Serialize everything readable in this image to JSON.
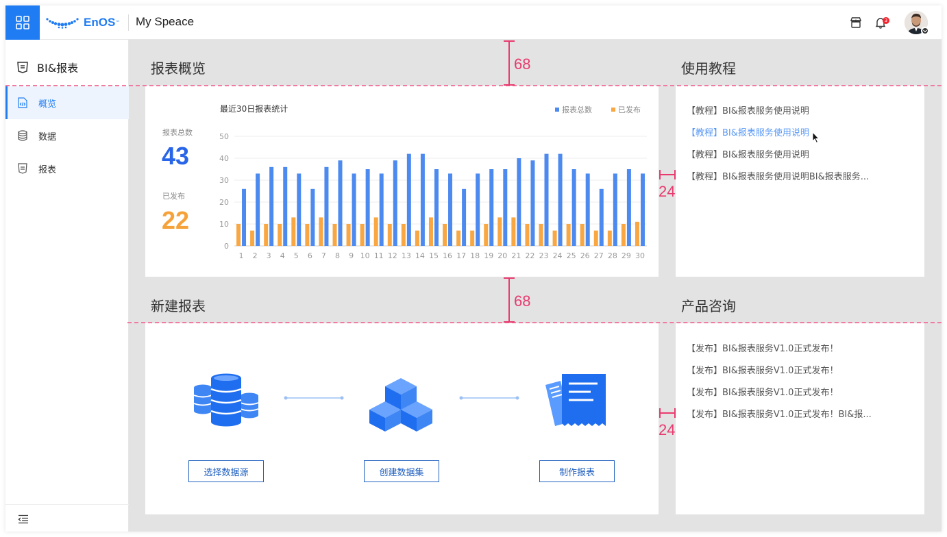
{
  "header": {
    "app_title": "My Speace",
    "logo_text": "EnOS",
    "logo_tm": "™",
    "notification_count": "3"
  },
  "sidebar": {
    "title": "BI&报表",
    "items": [
      {
        "label": "概览",
        "icon": "code-file-icon",
        "active": true
      },
      {
        "label": "数据",
        "icon": "database-icon",
        "active": false
      },
      {
        "label": "报表",
        "icon": "report-icon",
        "active": false
      }
    ]
  },
  "overview": {
    "section_title": "报表概览",
    "total_label": "报表总数",
    "total_value": "43",
    "published_label": "已发布",
    "published_value": "22",
    "colors": {
      "total": "#2865e8",
      "published": "#f6a23b"
    }
  },
  "chart_data": {
    "type": "bar",
    "title": "最近30日报表统计",
    "categories": [
      "1",
      "2",
      "3",
      "4",
      "5",
      "6",
      "7",
      "8",
      "9",
      "10",
      "11",
      "12",
      "13",
      "14",
      "15",
      "16",
      "17",
      "18",
      "19",
      "20",
      "21",
      "22",
      "23",
      "24",
      "25",
      "26",
      "27",
      "28",
      "29",
      "30"
    ],
    "series": [
      {
        "name": "报表总数",
        "color": "#4c8af0",
        "values": [
          26,
          33,
          36,
          36,
          33,
          26,
          36,
          39,
          33,
          35,
          33,
          39,
          42,
          42,
          35,
          33,
          26,
          33,
          35,
          35,
          40,
          39,
          42,
          42,
          35,
          33,
          26,
          33,
          35,
          33
        ]
      },
      {
        "name": "已发布",
        "color": "#f8a742",
        "values": [
          10,
          7,
          10,
          10,
          13,
          10,
          13,
          10,
          10,
          10,
          13,
          10,
          10,
          7,
          13,
          10,
          7,
          7,
          10,
          13,
          13,
          10,
          10,
          7,
          10,
          10,
          7,
          7,
          10,
          11
        ]
      }
    ],
    "yticks": [
      0,
      10,
      20,
      30,
      40,
      50
    ],
    "ylim": [
      0,
      50
    ],
    "legend_position": "top-right",
    "grid": true
  },
  "tutorial": {
    "section_title": "使用教程",
    "items": [
      "【教程】BI&报表服务使用说明",
      "【教程】BI&报表服务使用说明",
      "【教程】BI&报表服务使用说明",
      "【教程】BI&报表服务使用说明BI&报表服务..."
    ]
  },
  "new_report": {
    "section_title": "新建报表",
    "steps": [
      {
        "label": "选择数据源",
        "icon": "database-stack-icon"
      },
      {
        "label": "创建数据集",
        "icon": "cubes-icon"
      },
      {
        "label": "制作报表",
        "icon": "report-document-icon"
      }
    ]
  },
  "consult": {
    "section_title": "产品咨询",
    "items": [
      "【发布】BI&报表服务V1.0正式发布！",
      "【发布】BI&报表服务V1.0正式发布！",
      "【发布】BI&报表服务V1.0正式发布！",
      "【发布】BI&报表服务V1.0正式发布！BI&报..."
    ]
  },
  "annotations": {
    "gap_top": "68",
    "gap_mid": "68",
    "pad_tutorial": "24",
    "pad_consult": "24",
    "color": "#e83a6e"
  }
}
